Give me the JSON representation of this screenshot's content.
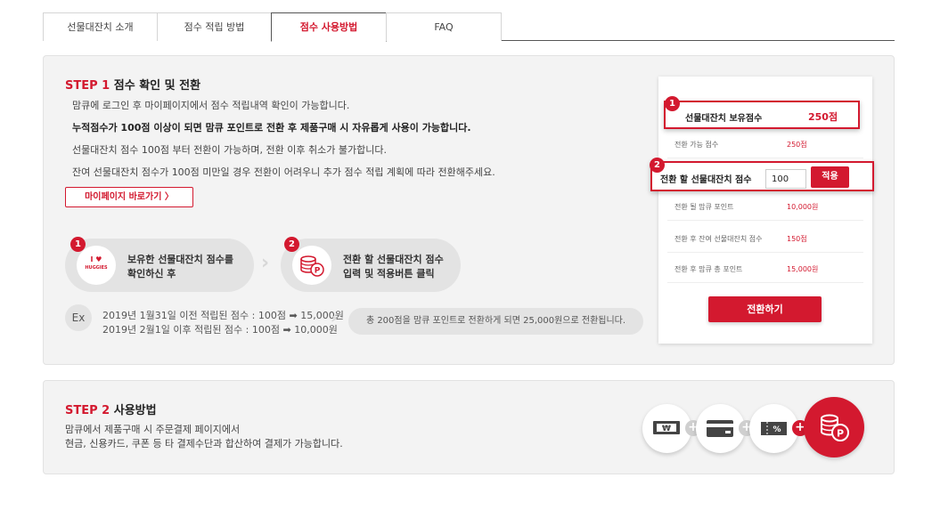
{
  "tabs": [
    "선물대잔치 소개",
    "점수 적립 방법",
    "점수 사용방법",
    "FAQ"
  ],
  "active_tab": "점수 사용방법",
  "step1": {
    "step_label": "STEP 1",
    "title": "점수 확인 및 전환",
    "lines": [
      "맘큐에 로그인 후 마이페이지에서 점수 적립내역 확인이 가능합니다.",
      "누적점수가 100점 이상이 되면 맘큐 포인트로 전환 후 제품구매 시 자유롭게 사용이 가능합니다.",
      "선물대잔치 점수 100점 부터 전환이 가능하며, 전환 이후 취소가 불가합니다.",
      "잔여 선물대잔치 점수가 100점 미만일 경우 전환이 어려우니 추가 점수 적립 계획에 따라 전환해주세요."
    ],
    "mypage_button": "마이페이지 바로가기 〉",
    "guide": [
      {
        "num": "1",
        "line1": "보유한 선물대잔치 점수를",
        "line2": "확인하신 후",
        "icon": "huggies-logo-icon",
        "logo_text": "I ♥",
        "logo_brand": "HUGGIES"
      },
      {
        "num": "2",
        "line1": "전환 할 선물대잔치 점수",
        "line2": "입력 및 적용버튼 클릭",
        "icon": "coin-stack-icon"
      }
    ],
    "example": {
      "badge": "Ex",
      "line1": "2019년 1월31일 이전 적립된 점수 : 100점 ➡ 15,000원",
      "line2": "2019년 2월1일 이후 적립된 점수 : 100점 ➡ 10,000원",
      "summary": "총 200점을 맘큐 포인트로 전환하게 되면 25,000원으로 전환됩니다."
    }
  },
  "card": {
    "badge1": "1",
    "badge2": "2",
    "held_label": "선물대잔치 보유점수",
    "held_value": "250점",
    "convertible_label": "전환 가능 점수",
    "convertible_value": "250점",
    "convert_label": "전환 할 선물대잔치 점수",
    "convert_input_value": "100",
    "apply_button": "적용",
    "rows": [
      {
        "label": "전환 될 맘큐 포인트",
        "value": "10,000원"
      },
      {
        "label": "전환 후 잔여 선물대잔치 점수",
        "value": "150점"
      },
      {
        "label": "전환 후 맘큐 총 포인트",
        "value": "15,000원"
      }
    ],
    "convert_button": "전환하기"
  },
  "step2": {
    "step_label": "STEP 2",
    "title": "사용방법",
    "line1": "맘큐에서 제품구매 시 주문결제 페이지에서",
    "line2": "현금, 신용카드, 쿠폰 등 타 결제수단과 합산하여 결제가 가능합니다.",
    "payment_icons": [
      "cash-won-icon",
      "credit-card-icon",
      "coupon-icon",
      "point-coin-icon"
    ],
    "cash_symbol": "₩",
    "coupon_symbol": "%",
    "plus": "+"
  },
  "colors": {
    "accent": "#d3192f",
    "panel_bg": "#f3f3f3",
    "pill_bg": "#e3e3e3"
  }
}
